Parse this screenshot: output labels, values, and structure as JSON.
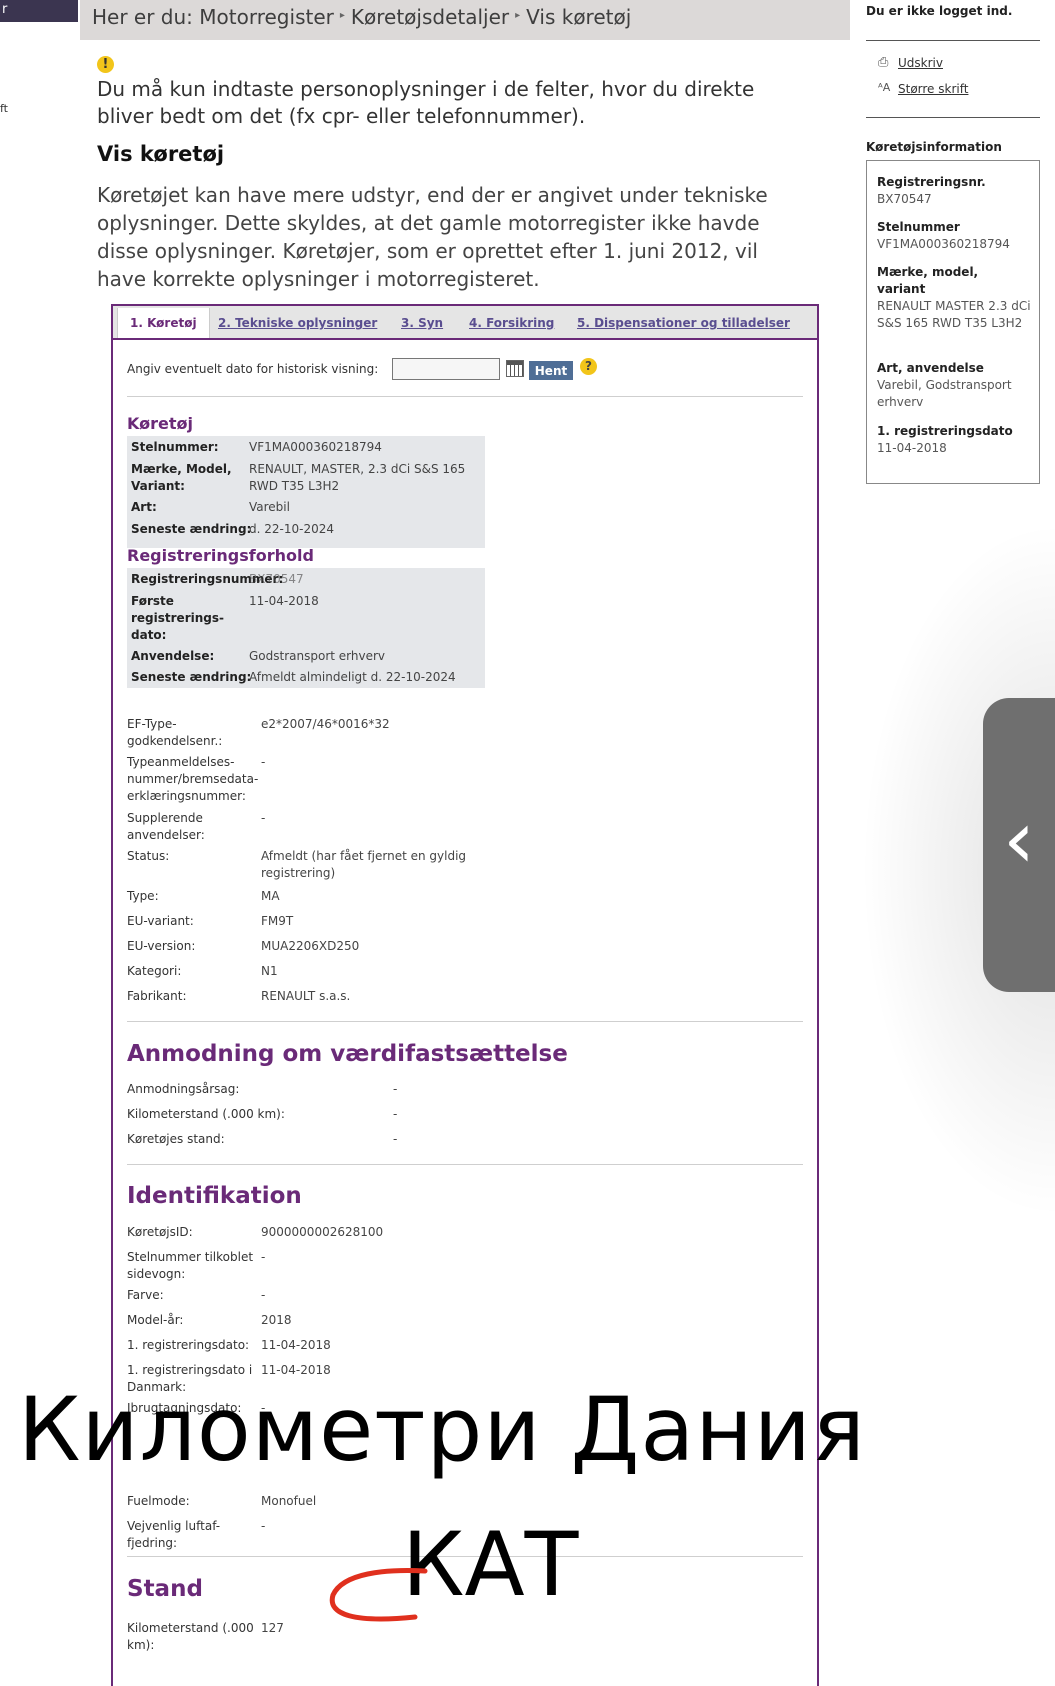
{
  "top_left": {
    "corner_text": "r",
    "side_text": "ft"
  },
  "breadcrumb": {
    "label": "Her er du:",
    "items": [
      "Motorregister",
      "Køretøjsdetaljer",
      "Vis køretøj"
    ]
  },
  "notice": {
    "icon": "warning-icon",
    "text": "Du må kun indtaste personoplysninger i de felter, hvor du direkte bliver bedt om det (fx cpr- eller telefonnummer)."
  },
  "page": {
    "title": "Vis køretøj",
    "intro": "Køretøjet kan have mere udstyr, end der er angivet under tekniske oplysninger. Dette skyldes, at det gamle motorregister ikke havde disse oplysninger. Køretøjer, som er oprettet efter 1. juni 2012, vil have korrekte oplysninger i motorregisteret."
  },
  "tabs": [
    {
      "label": "1. Køretøj",
      "active": true
    },
    {
      "label": "2. Tekniske oplysninger",
      "active": false
    },
    {
      "label": "3. Syn",
      "active": false
    },
    {
      "label": "4. Forsikring",
      "active": false
    },
    {
      "label": "5. Dispensationer og tilladelser",
      "active": false
    }
  ],
  "history": {
    "label": "Angiv eventuelt dato for historisk visning:",
    "input_value": "",
    "button_label": "Hent",
    "help": "?"
  },
  "koretoj": {
    "title": "Køretøj",
    "rows": [
      {
        "label": "Stelnummer:",
        "value": "VF1MA000360218794"
      },
      {
        "label": "Mærke, Model, Variant:",
        "value": "RENAULT, MASTER, 2.3 dCi S&S 165 RWD T35 L3H2"
      },
      {
        "label": "Art:",
        "value": "Varebil"
      },
      {
        "label": "Seneste ændring:",
        "value": "d. 22-10-2024"
      }
    ]
  },
  "registrering": {
    "title": "Registreringsforhold",
    "rows": [
      {
        "label": "Registreringsnummer:",
        "value": "BX70547"
      },
      {
        "label": "Første registrerings-dato:",
        "value": "11-04-2018"
      },
      {
        "label": "Anvendelse:",
        "value": "Godstransport erhverv"
      },
      {
        "label": "Seneste ændring:",
        "value": "Afmeldt almindeligt d. 22-10-2024"
      }
    ]
  },
  "details": [
    {
      "label": "EF-Type-godkendelsenr.:",
      "value": "e2*2007/46*0016*32"
    },
    {
      "label": "Typeanmeldelses-nummer/bremsedata-erklæringsnummer:",
      "value": "-"
    },
    {
      "label": "Supplerende anvendelser:",
      "value": "-"
    },
    {
      "label": "Status:",
      "value": "Afmeldt (har fået fjernet en gyldig registrering)"
    },
    {
      "label": "Type:",
      "value": "MA"
    },
    {
      "label": "EU-variant:",
      "value": "FM9T"
    },
    {
      "label": "EU-version:",
      "value": "MUA2206XD250"
    },
    {
      "label": "Kategori:",
      "value": "N1"
    },
    {
      "label": "Fabrikant:",
      "value": "RENAULT s.a.s."
    }
  ],
  "anmodning": {
    "title": "Anmodning om værdifastsættelse",
    "rows": [
      {
        "label": "Anmodningsårsag:",
        "value": "-"
      },
      {
        "label": "Kilometerstand (.000 km):",
        "value": "-"
      },
      {
        "label": "Køretøjes stand:",
        "value": "-"
      }
    ]
  },
  "identifikation": {
    "title": "Identifikation",
    "rows": [
      {
        "label": "KøretøjsID:",
        "value": "9000000002628100"
      },
      {
        "label": "Stelnummer tilkoblet sidevogn:",
        "value": "-"
      },
      {
        "label": "Farve:",
        "value": "-"
      },
      {
        "label": "Model-år:",
        "value": "2018"
      },
      {
        "label": "1. registreringsdato:",
        "value": "11-04-2018"
      },
      {
        "label": "1. registreringsdato i Danmark:",
        "value": "11-04-2018"
      },
      {
        "label": "Ibrugtagningsdato:",
        "value": "-"
      },
      {
        "label": "Fuelmode:",
        "value": "Monofuel"
      },
      {
        "label": "Vejvenlig luftaf-fjedring:",
        "value": "-"
      }
    ]
  },
  "stand": {
    "title": "Stand",
    "rows": [
      {
        "label": "Kilometerstand (.000 km):",
        "value": "127"
      }
    ]
  },
  "overlay": {
    "line1": "Километри  Дания",
    "line2": "КАТ",
    "arrow_color": "#e0301e"
  },
  "sidebar": {
    "login_status": "Du er ikke logget ind.",
    "links": [
      {
        "label": "Udskriv",
        "icon": "print-icon"
      },
      {
        "label": "Større skrift",
        "icon": "font-size-icon"
      }
    ],
    "info_title": "Køretøjsinformation",
    "info": [
      {
        "label": "Registreringsnr.",
        "value": "BX70547"
      },
      {
        "label": "Stelnummer",
        "value": "VF1MA000360218794"
      },
      {
        "label": "Mærke, model, variant",
        "value": "RENAULT MASTER 2.3 dCi S&S 165 RWD T35 L3H2"
      },
      {
        "label": "Art, anvendelse",
        "value": "Varebil, Godstransport erhverv"
      },
      {
        "label": "1. registreringsdato",
        "value": "11-04-2018"
      }
    ]
  },
  "colors": {
    "accent": "#6a2a78",
    "tab_link": "#5a4e90",
    "button": "#4f6e96",
    "warning": "#f2c51a"
  }
}
